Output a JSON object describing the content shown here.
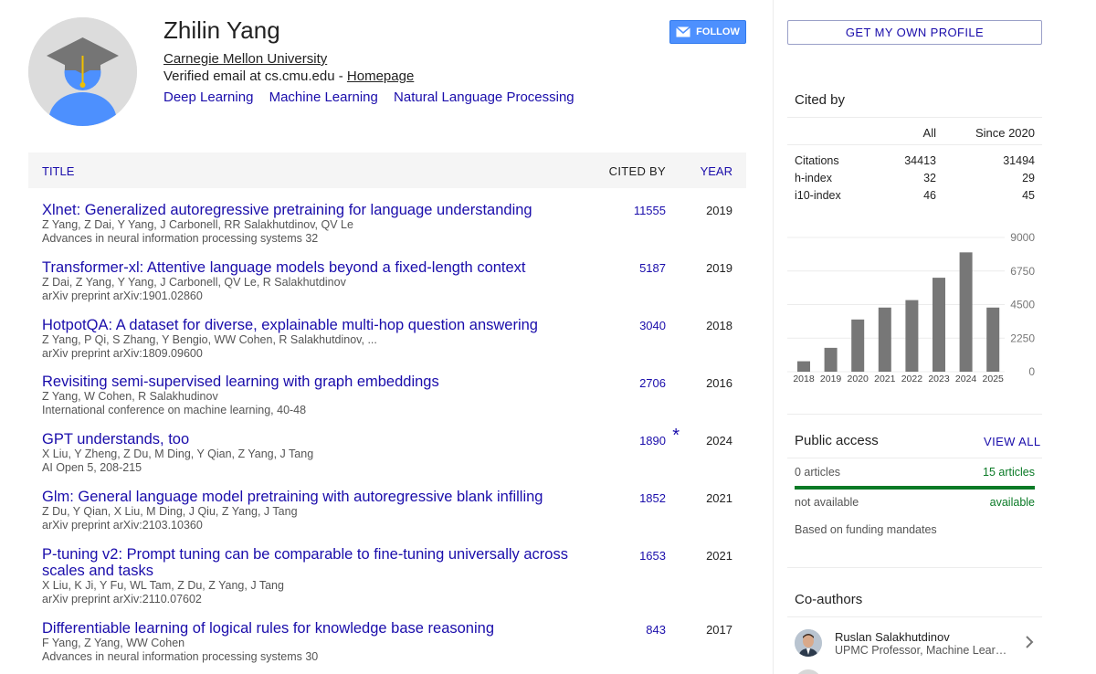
{
  "profile": {
    "name": "Zhilin Yang",
    "affiliation": "Carnegie Mellon University",
    "email_text": "Verified email at cs.cmu.edu - ",
    "homepage": "Homepage",
    "interests": [
      "Deep Learning",
      "Machine Learning",
      "Natural Language Processing"
    ],
    "follow_label": "FOLLOW"
  },
  "table": {
    "header_title": "TITLE",
    "header_cited": "CITED BY",
    "header_year": "YEAR",
    "rows": [
      {
        "title": "Xlnet: Generalized autoregressive pretraining for language understanding",
        "authors": "Z Yang, Z Dai, Y Yang, J Carbonell, RR Salakhutdinov, QV Le",
        "venue": "Advances in neural information processing systems 32",
        "cited": "11555",
        "year": "2019"
      },
      {
        "title": "Transformer-xl: Attentive language models beyond a fixed-length context",
        "authors": "Z Dai, Z Yang, Y Yang, J Carbonell, QV Le, R Salakhutdinov",
        "venue": "arXiv preprint arXiv:1901.02860",
        "cited": "5187",
        "year": "2019"
      },
      {
        "title": "HotpotQA: A dataset for diverse, explainable multi-hop question answering",
        "authors": "Z Yang, P Qi, S Zhang, Y Bengio, WW Cohen, R Salakhutdinov, ...",
        "venue": "arXiv preprint arXiv:1809.09600",
        "cited": "3040",
        "year": "2018"
      },
      {
        "title": "Revisiting semi-supervised learning with graph embeddings",
        "authors": "Z Yang, W Cohen, R Salakhudinov",
        "venue": "International conference on machine learning, 40-48",
        "cited": "2706",
        "year": "2016"
      },
      {
        "title": "GPT understands, too",
        "authors": "X Liu, Y Zheng, Z Du, M Ding, Y Qian, Z Yang, J Tang",
        "venue": "AI Open 5, 208-215",
        "cited": "1890",
        "year": "2024",
        "star": "*"
      },
      {
        "title": "Glm: General language model pretraining with autoregressive blank infilling",
        "authors": "Z Du, Y Qian, X Liu, M Ding, J Qiu, Z Yang, J Tang",
        "venue": "arXiv preprint arXiv:2103.10360",
        "cited": "1852",
        "year": "2021"
      },
      {
        "title": "P-tuning v2: Prompt tuning can be comparable to fine-tuning universally across scales and tasks",
        "authors": "X Liu, K Ji, Y Fu, WL Tam, Z Du, Z Yang, J Tang",
        "venue": "arXiv preprint arXiv:2110.07602",
        "cited": "1653",
        "year": "2021"
      },
      {
        "title": "Differentiable learning of logical rules for knowledge base reasoning",
        "authors": "F Yang, Z Yang, WW Cohen",
        "venue": "Advances in neural information processing systems 30",
        "cited": "843",
        "year": "2017"
      }
    ]
  },
  "sidebar": {
    "own_profile_label": "GET MY OWN PROFILE",
    "cited_by_title": "Cited by",
    "col_all": "All",
    "col_since": "Since 2020",
    "stats": [
      {
        "label": "Citations",
        "all": "34413",
        "since": "31494"
      },
      {
        "label": "h-index",
        "all": "32",
        "since": "29"
      },
      {
        "label": "i10-index",
        "all": "46",
        "since": "45"
      }
    ],
    "public_access_title": "Public access",
    "view_all": "VIEW ALL",
    "pa_left_count": "0 articles",
    "pa_right_count": "15 articles",
    "pa_left_status": "not available",
    "pa_right_status": "available",
    "pa_note": "Based on funding mandates",
    "pa_available_fraction": 1.0,
    "coauthors_title": "Co-authors",
    "coauthor": {
      "name": "Ruslan Salakhutdinov",
      "affiliation": "UPMC Professor, Machine Learning Department, CMU"
    }
  },
  "chart_data": {
    "type": "bar",
    "categories": [
      "2018",
      "2019",
      "2020",
      "2021",
      "2022",
      "2023",
      "2024",
      "2025"
    ],
    "values": [
      700,
      1600,
      3500,
      4300,
      4800,
      6300,
      8000,
      4300
    ],
    "yticks": [
      "9000",
      "6750",
      "4500",
      "2250",
      "0"
    ],
    "ylim": [
      0,
      9000
    ],
    "bar_color": "#777777",
    "grid": true
  },
  "colors": {
    "link": "#1a0dab",
    "follow_button": "#4d90fe",
    "available_green": "#0a7a26"
  }
}
